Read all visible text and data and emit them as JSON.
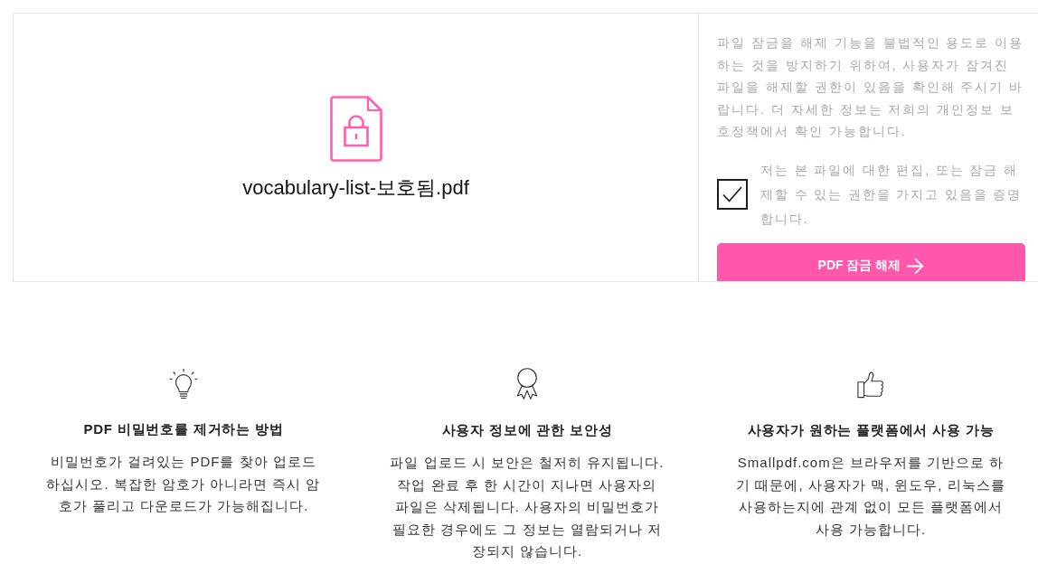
{
  "file": {
    "name": "vocabulary-list-보호됨.pdf"
  },
  "notice": "파일 잠금을 해제 기능을 불법적인 용도로 이용하는 것을 방지하기 위하여, 사용자가 잠겨진 파일을 해제할 권한이 있음을 확인해 주시기 바랍니다. 더 자세한 정보는 저희의 개인정보 보호정책에서 확인 가능합니다.",
  "consent": {
    "checked": true,
    "label": "저는 본 파일에 대한 편집, 또는 잠금 해제할 수 있는 권한을 가지고 있음을 증명합니다."
  },
  "unlock_button": {
    "label": "PDF 잠금 해제"
  },
  "features": [
    {
      "title": "PDF 비밀번호를 제거하는 방법",
      "text": "비밀번호가 걸려있는 PDF를 찾아 업로드하십시오. 복잡한 암호가 아니라면 즉시 암호가 풀리고 다운로드가 가능해집니다."
    },
    {
      "title": "사용자 정보에 관한 보안성",
      "text": "파일 업로드 시 보안은 철저히 유지됩니다. 작업 완료 후 한 시간이 지나면 사용자의 파일은 삭제됩니다. 사용자의 비밀번호가 필요한 경우에도 그 정보는 열람되거나 저장되지 않습니다."
    },
    {
      "title": "사용자가 원하는 플랫폼에서 사용 가능",
      "text": "Smallpdf.com은 브라우저를 기반으로 하기 때문에, 사용자가 맥, 윈도우, 리눅스를 사용하는지에 관계 없이 모든 플랫폼에서 사용 가능합니다."
    }
  ]
}
